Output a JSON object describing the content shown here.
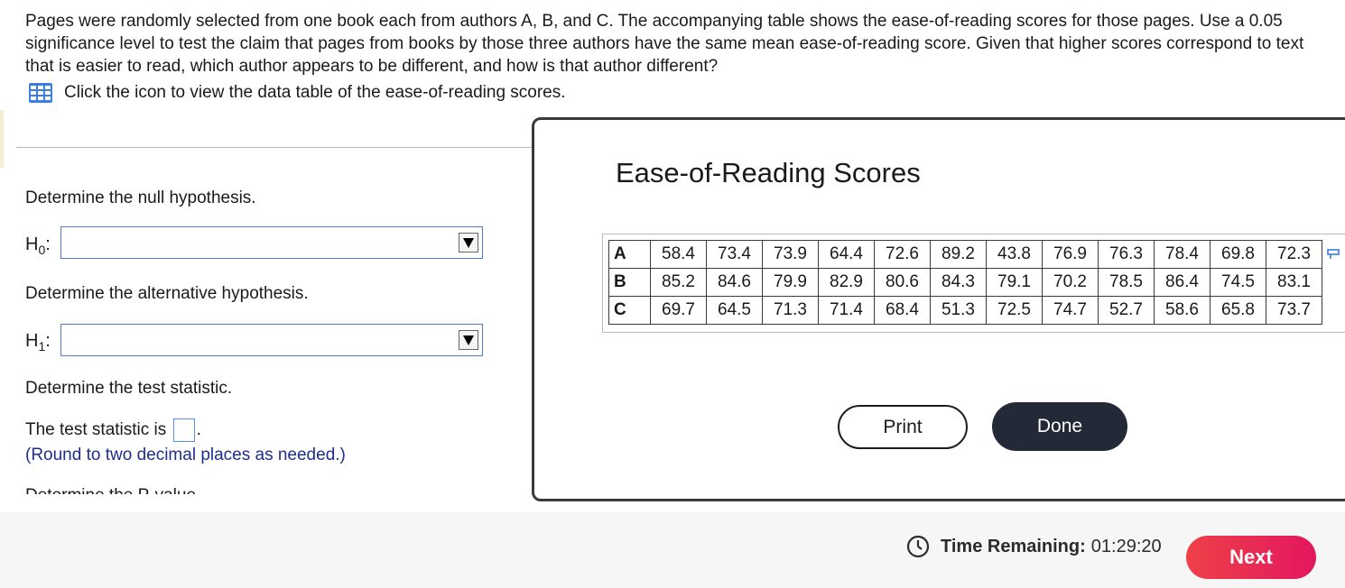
{
  "question": {
    "text": "Pages were randomly selected from one book each from authors A, B, and C. The accompanying table shows the ease-of-reading scores for those pages. Use a 0.05 significance level to test the claim that pages from books by those three authors have the same mean ease-of-reading score. Given that higher scores correspond to text that is easier to read, which author appears to be different, and how is that author different?",
    "table_link": "Click the icon to view the data table of the ease-of-reading scores."
  },
  "steps": {
    "null_label": "Determine the null hypothesis.",
    "h0": "H",
    "h0_sub": "0",
    "alt_label": "Determine the alternative hypothesis.",
    "h1": "H",
    "h1_sub": "1",
    "stat_label": "Determine the test statistic.",
    "stat_prefix": "The test statistic is",
    "stat_suffix": ".",
    "round_note": "(Round to two decimal places as needed.)",
    "pvalue_label": "Determine the P-value."
  },
  "modal": {
    "title": "Ease-of-Reading Scores",
    "rows": [
      {
        "label": "A",
        "values": [
          "58.4",
          "73.4",
          "73.9",
          "64.4",
          "72.6",
          "89.2",
          "43.8",
          "76.9",
          "76.3",
          "78.4",
          "69.8",
          "72.3"
        ]
      },
      {
        "label": "B",
        "values": [
          "85.2",
          "84.6",
          "79.9",
          "82.9",
          "80.6",
          "84.3",
          "79.1",
          "70.2",
          "78.5",
          "86.4",
          "74.5",
          "83.1"
        ]
      },
      {
        "label": "C",
        "values": [
          "69.7",
          "64.5",
          "71.3",
          "71.4",
          "68.4",
          "51.3",
          "72.5",
          "74.7",
          "52.7",
          "58.6",
          "65.8",
          "73.7"
        ]
      }
    ],
    "print_label": "Print",
    "done_label": "Done"
  },
  "footer": {
    "time_label": "Time Remaining:",
    "time_value": "01:29:20",
    "next_label": "Next"
  },
  "colors": {
    "accent_blue": "#4f7bd1",
    "note_blue": "#1f2e8a",
    "next_red": "#ea2a55",
    "done_dark": "#232936"
  },
  "icons": [
    "data-table-icon",
    "dropdown-arrow-icon",
    "clock-icon",
    "copy-icon"
  ]
}
